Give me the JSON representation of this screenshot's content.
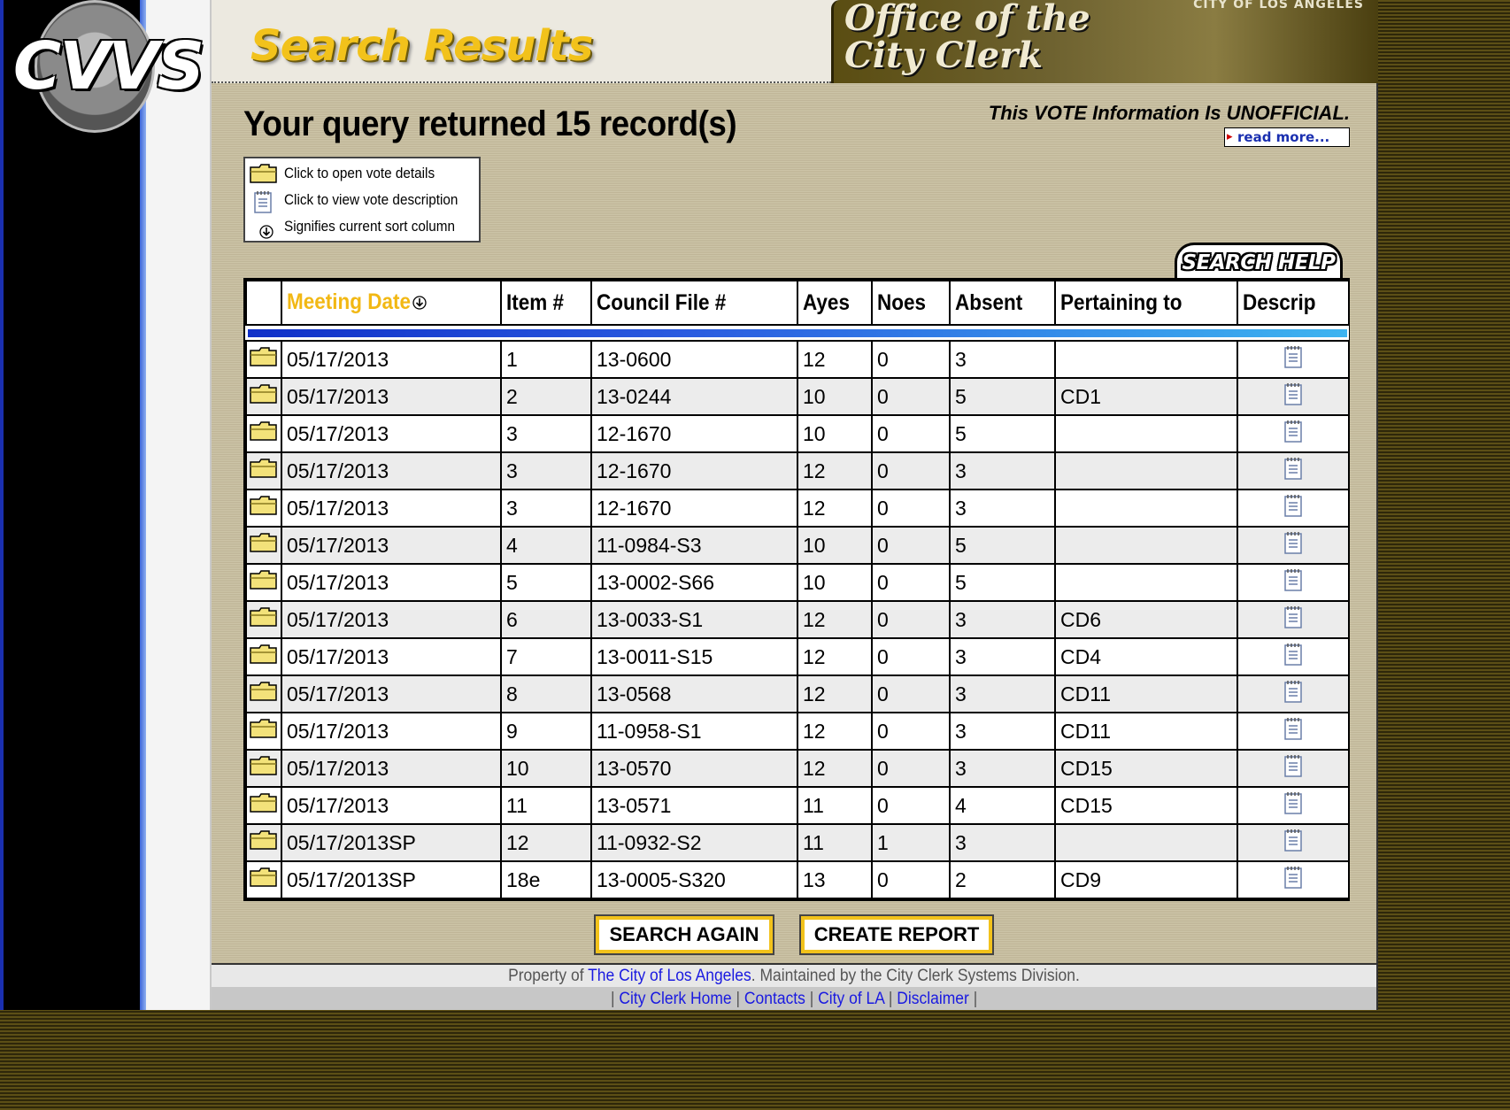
{
  "logo": {
    "text": "CVVS"
  },
  "header": {
    "title": "Search Results",
    "office_title_line1": "Office of the",
    "office_title_line2": "City Clerk",
    "city_label": "CITY OF LOS ANGELES"
  },
  "query_heading": "Your query returned 15 record(s)",
  "notice": {
    "text": "This VOTE Information Is UNOFFICIAL.",
    "read_more": "read more..."
  },
  "legend": [
    {
      "icon": "folder-icon",
      "text": "Click to open vote details"
    },
    {
      "icon": "notepad-icon",
      "text": "Click to view vote description"
    },
    {
      "icon": "sort-arrow-icon",
      "text": "Signifies current sort column"
    }
  ],
  "search_help_label": "SEARCH HELP",
  "table": {
    "columns": [
      "",
      "Meeting Date",
      "Item #",
      "Council File #",
      "Ayes",
      "Noes",
      "Absent",
      "Pertaining to",
      "Descrip"
    ],
    "sorted_column": "Meeting Date",
    "rows": [
      [
        "05/17/2013",
        "1",
        "13-0600",
        "12",
        "0",
        "3",
        ""
      ],
      [
        "05/17/2013",
        "2",
        "13-0244",
        "10",
        "0",
        "5",
        "CD1"
      ],
      [
        "05/17/2013",
        "3",
        "12-1670",
        "10",
        "0",
        "5",
        ""
      ],
      [
        "05/17/2013",
        "3",
        "12-1670",
        "12",
        "0",
        "3",
        ""
      ],
      [
        "05/17/2013",
        "3",
        "12-1670",
        "12",
        "0",
        "3",
        ""
      ],
      [
        "05/17/2013",
        "4",
        "11-0984-S3",
        "10",
        "0",
        "5",
        ""
      ],
      [
        "05/17/2013",
        "5",
        "13-0002-S66",
        "10",
        "0",
        "5",
        ""
      ],
      [
        "05/17/2013",
        "6",
        "13-0033-S1",
        "12",
        "0",
        "3",
        "CD6"
      ],
      [
        "05/17/2013",
        "7",
        "13-0011-S15",
        "12",
        "0",
        "3",
        "CD4"
      ],
      [
        "05/17/2013",
        "8",
        "13-0568",
        "12",
        "0",
        "3",
        "CD11"
      ],
      [
        "05/17/2013",
        "9",
        "11-0958-S1",
        "12",
        "0",
        "3",
        "CD11"
      ],
      [
        "05/17/2013",
        "10",
        "13-0570",
        "12",
        "0",
        "3",
        "CD15"
      ],
      [
        "05/17/2013",
        "11",
        "13-0571",
        "11",
        "0",
        "4",
        "CD15"
      ],
      [
        "05/17/2013SP",
        "12",
        "11-0932-S2",
        "11",
        "1",
        "3",
        ""
      ],
      [
        "05/17/2013SP",
        "18e",
        "13-0005-S320",
        "13",
        "0",
        "2",
        "CD9"
      ]
    ]
  },
  "buttons": {
    "search_again": "SEARCH AGAIN",
    "create_report": "CREATE REPORT"
  },
  "footer": {
    "prefix": "Property of ",
    "city_link": "The City of Los Angeles",
    "suffix": ". Maintained by the City Clerk Systems Division.",
    "links": [
      "City Clerk Home",
      "Contacts",
      "City of LA",
      "Disclaimer"
    ]
  },
  "colors": {
    "accent_gold": "#f2c21b",
    "link_blue": "#1a1ae0",
    "panel_tan": "#c9c0a3"
  }
}
